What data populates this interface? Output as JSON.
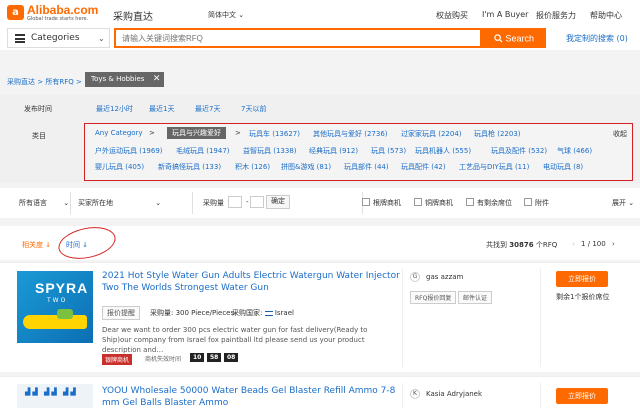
{
  "header": {
    "logo_mark": "a",
    "logo_word": "Alibaba.com",
    "logo_tagline": "Global trade starts here.",
    "site_title": "采购直达",
    "language": "简体中文",
    "language_chevron": "⌄",
    "nav": [
      "权益购买",
      "I'm A Buyer",
      "报价服务力",
      "帮助中心"
    ]
  },
  "search": {
    "category_label": "Categories",
    "category_chevron": "⌄",
    "placeholder": "请输入关键词搜索RFQ",
    "button_label": "Search",
    "my_search": "我定制的搜索 (0)"
  },
  "breadcrumb": {
    "items": [
      "采购直达",
      "所有RFQ"
    ],
    "chip": "Toys & Hobbies",
    "chip_close": "✕"
  },
  "filters": {
    "time_label": "发布时间",
    "time_options": [
      "最近12小时",
      "最近1天",
      "最近7天",
      "7天以前"
    ],
    "category_label": "类目",
    "rows": [
      [
        "Any Category",
        "玩具与兴趣爱好",
        "玩具车 (13627)",
        "其他玩具与爱好 (2736)",
        "过家家玩具 (2204)",
        "玩具枪 (2203)"
      ],
      [
        "户外运动玩具 (1969)",
        "毛绒玩具 (1947)",
        "益智玩具 (1338)",
        "经典玩具 (912)",
        "玩具 (573)",
        "玩具机器人 (555)",
        "玩具及配件 (532)",
        "气球 (466)"
      ],
      [
        "婴儿玩具 (405)",
        "新奇搞怪玩具 (133)",
        "积木 (126)",
        "拼图&游戏 (81)",
        "玩具部件 (44)",
        "玩具配件 (42)",
        "工艺品与DIY玩具 (11)",
        "电动玩具 (8)"
      ]
    ],
    "collapse": "收起"
  },
  "filter_bar": {
    "language": "所有语言",
    "buyer_country": "买家所在地",
    "quantity_label": "采购量",
    "range_sep": "-",
    "confirm": "确定",
    "checkboxes": [
      "根牌商机",
      "铜牌商机",
      "有剩余席位",
      "附件"
    ],
    "expand": "展开"
  },
  "sort": {
    "relevance": "相关度",
    "time": "时间",
    "count_prefix": "共找到",
    "count": "30876",
    "count_suffix": "个RFQ",
    "page_current": "1",
    "page_total": "/ 100"
  },
  "listings": [
    {
      "thumb_brand": "SPYRA",
      "thumb_sub": "TWO",
      "title": "2021 Hot Style Water Gun Adults Electric Watergun Water Injector Two The Worlds Strongest Water Gun",
      "tag": "报价提醒",
      "quantity_label": "采购量:",
      "quantity": "300 Piece/Pieces",
      "country_label": "采购国家:",
      "country": "Israel",
      "desc": "Dear we want to order 300 pcs electric water gun for fast delivery(Ready to Ship)our company from Israel fox paintball ltd please send us your product description and…",
      "badge": "银牌商机",
      "expire_label": "商机失效时间",
      "timer": [
        "10",
        "58",
        "08"
      ],
      "buyer_avatar": "G",
      "buyer": "gas azzam",
      "buyer_tags": [
        "RFQ报价回复",
        "邮件认证"
      ],
      "quote_btn": "立即报价",
      "remain": "剩余1个报价席位"
    },
    {
      "title": "YOOU Wholesale 50000 Water Beads Gel Blaster Refill Ammo 7-8 mm Gel Balls Blaster Ammo",
      "buyer_avatar": "K",
      "buyer": "Kasia Adryjanek",
      "quote_btn": "立即报价"
    }
  ]
}
